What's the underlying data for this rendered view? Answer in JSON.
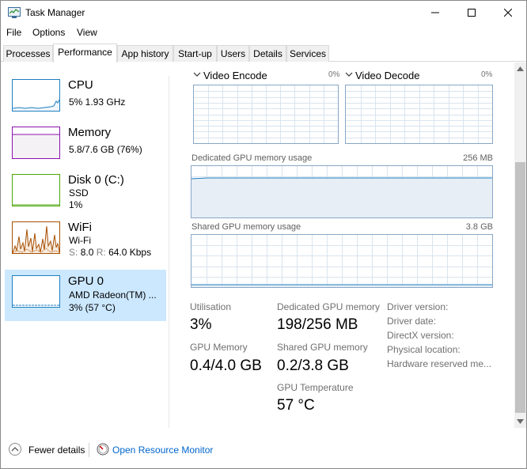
{
  "window": {
    "title": "Task Manager"
  },
  "menu": [
    "File",
    "Options",
    "View"
  ],
  "tabs": [
    "Processes",
    "Performance",
    "App history",
    "Start-up",
    "Users",
    "Details",
    "Services"
  ],
  "active_tab": "Performance",
  "sidebar": [
    {
      "name": "CPU",
      "sub1": "5% 1.93 GHz",
      "color": "#1d7fc0"
    },
    {
      "name": "Memory",
      "sub1": "5.8/7.6 GB (76%)",
      "color": "#8b12ae"
    },
    {
      "name": "Disk 0 (C:)",
      "sub1": "SSD",
      "sub2": "1%",
      "color": "#4da60c"
    },
    {
      "name": "WiFi",
      "sub1": "Wi-Fi",
      "sub2_s_label": "S:",
      "sub2_s_value": "8.0",
      "sub2_r_label": "R:",
      "sub2_r_value": "64.0 Kbps",
      "color": "#a74f01"
    },
    {
      "name": "GPU 0",
      "sub1": "AMD Radeon(TM) ...",
      "sub2": "3% (57 °C)",
      "color": "#1d7fc0",
      "selected": true
    }
  ],
  "engines": [
    {
      "name": "Video Encode",
      "percent": "0%"
    },
    {
      "name": "Video Decode",
      "percent": "0%"
    }
  ],
  "dedicated_graph": {
    "label": "Dedicated GPU memory usage",
    "max": "256 MB"
  },
  "shared_graph": {
    "label": "Shared GPU memory usage",
    "max": "3.8 GB"
  },
  "stats": {
    "utilisation_label": "Utilisation",
    "utilisation_value": "3%",
    "gpu_memory_label": "GPU Memory",
    "gpu_memory_value": "0.4/4.0 GB",
    "dedicated_label": "Dedicated GPU memory",
    "dedicated_value": "198/256 MB",
    "shared_label": "Shared GPU memory",
    "shared_value": "0.2/3.8 GB",
    "temp_label": "GPU Temperature",
    "temp_value": "57 °C"
  },
  "info_labels": [
    "Driver version:",
    "Driver date:",
    "DirectX version:",
    "Physical location:",
    "Hardware reserved me..."
  ],
  "footer": {
    "fewer_details": "Fewer details",
    "open_resource_monitor": "Open Resource Monitor"
  },
  "colors": {
    "accent": "#1d7fc0",
    "selected_bg": "#cce8ff",
    "graph_border": "#87a7c6",
    "link": "#0066cc"
  }
}
